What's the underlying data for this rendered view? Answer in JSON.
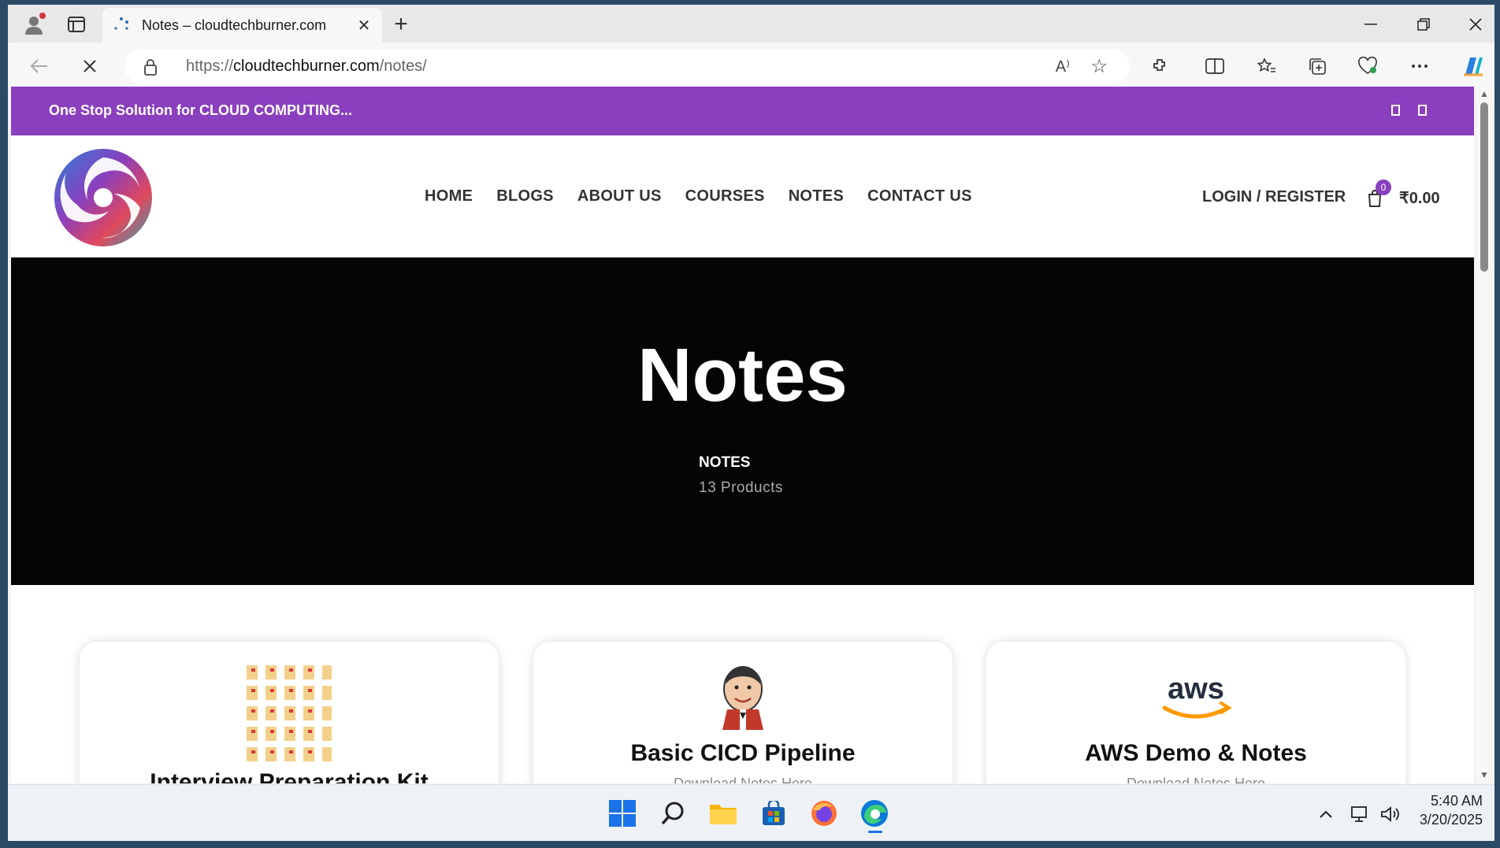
{
  "browser": {
    "tab_title": "Notes – cloudtechburner.com",
    "tab_close": "✕",
    "new_tab": "+",
    "url_scheme": "https://",
    "url_domain": "cloudtechburner.com",
    "url_path": "/notes/",
    "read_aloud": "A⁾"
  },
  "site": {
    "promo_text": "One Stop Solution for CLOUD COMPUTING...",
    "nav": [
      "HOME",
      "BLOGS",
      "ABOUT US",
      "COURSES",
      "NOTES",
      "CONTACT US"
    ],
    "login": "LOGIN / REGISTER",
    "cart_count": "0",
    "cart_total": "₹0.00",
    "brand_color": "#8a3fbe"
  },
  "hero": {
    "title": "Notes",
    "breadcrumb": "NOTES",
    "product_count": "13 Products"
  },
  "products": [
    {
      "title": "Interview Preparation Kit",
      "subtitle": "",
      "image": "document-grid-icon"
    },
    {
      "title": "Basic CICD Pipeline",
      "subtitle": "Download Notes Here",
      "image": "jenkins-icon"
    },
    {
      "title": "AWS Demo & Notes",
      "subtitle": "Download Notes Here",
      "image": "aws-logo",
      "logo_text": "aws"
    }
  ],
  "taskbar": {
    "time": "5:40 AM",
    "date": "3/20/2025"
  }
}
